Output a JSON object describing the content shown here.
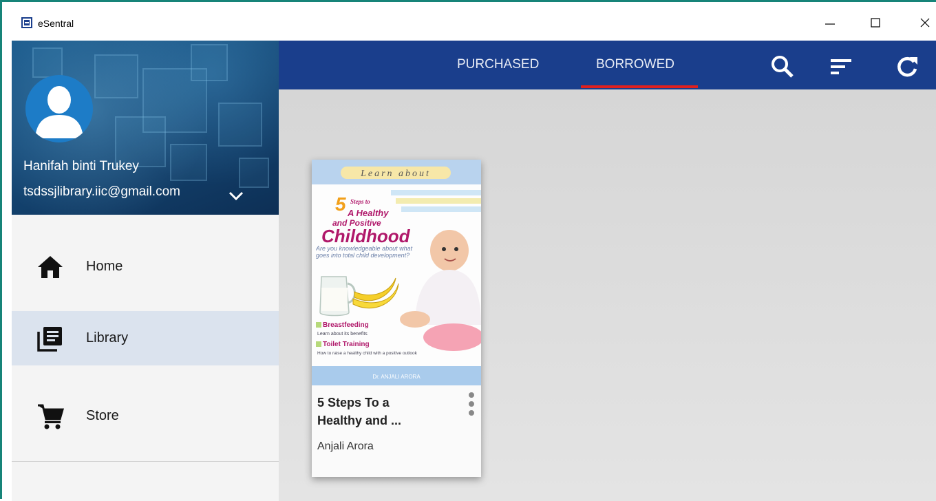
{
  "window": {
    "title": "eSentral",
    "minimize_label": "—",
    "maximize_label": "☐",
    "close_label": "✕"
  },
  "profile": {
    "name": "Hanifah binti Trukey",
    "email": "tsdssjlibrary.iic@gmail.com"
  },
  "sidebar": {
    "items": [
      {
        "label": "Home",
        "icon": "home-icon",
        "active": false
      },
      {
        "label": "Library",
        "icon": "library-icon",
        "active": true
      },
      {
        "label": "Store",
        "icon": "cart-icon",
        "active": false
      }
    ]
  },
  "topbar": {
    "tabs": [
      {
        "label": "PURCHASED",
        "active": false
      },
      {
        "label": "BORROWED",
        "active": true
      }
    ],
    "accent_color": "#e0201f",
    "bar_color": "#1a3e8c"
  },
  "books": [
    {
      "title_line1": "5 Steps To a",
      "title_line2": "Healthy and ...",
      "author": "Anjali Arora",
      "cover": {
        "banner": "Learn about",
        "number": "5",
        "steps_to": "Steps to",
        "a_healthy": "A Healthy",
        "and_positive": "and Positive",
        "childhood": "Childhood",
        "tagline": "Are you knowledgeable about what goes into total child development?",
        "bullet1_title": "Breastfeeding",
        "bullet1_text": "Learn about its benefits",
        "bullet2_title": "Toilet Training",
        "bullet2_text": "How to raise a healthy child with a positive outlook",
        "author_band": "Dr. ANJALI ARORA"
      }
    }
  ]
}
